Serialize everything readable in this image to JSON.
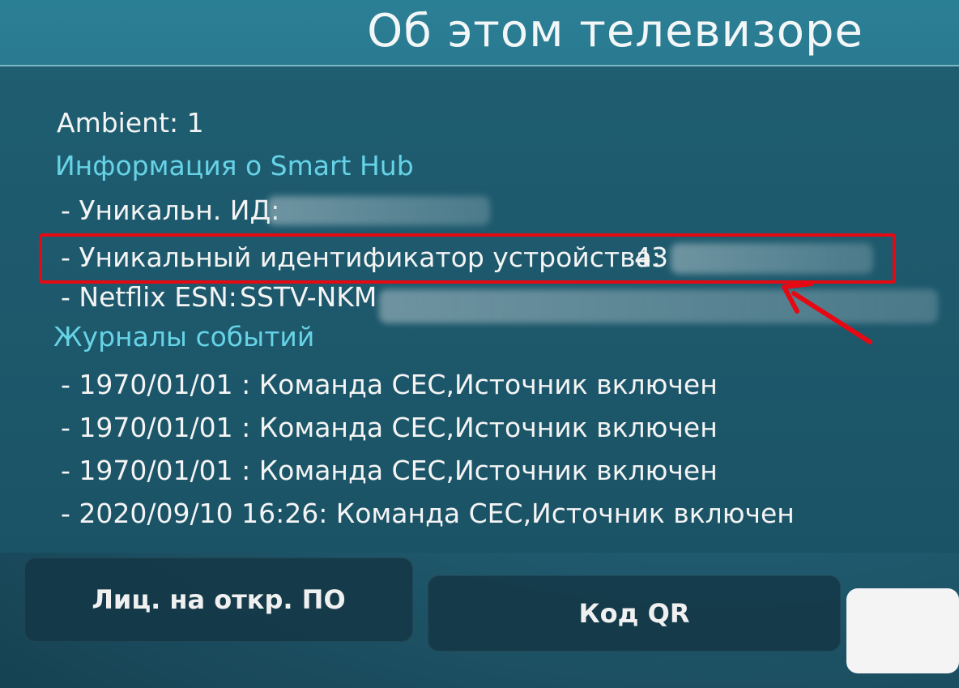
{
  "header": {
    "title": "Об этом телевизоре"
  },
  "info": {
    "ambient": "Ambient: 1",
    "smart_hub_heading": "Информация о Smart Hub",
    "unique_id_label": "- Уникальн. ИД:",
    "device_id_label": "- Уникальный идентификатор устройства:",
    "device_id_value": "43",
    "netflix_label": "- Netflix ESN:",
    "netflix_value": "SSTV-NKM"
  },
  "event_logs": {
    "heading": "Журналы событий",
    "entries": [
      "- 1970/01/01 : Команда CEC,Источник включен",
      "- 1970/01/01 : Команда CEC,Источник включен",
      "- 1970/01/01 : Команда CEC,Источник включен",
      "- 2020/09/10 16:26: Команда CEC,Источник включен"
    ]
  },
  "buttons": {
    "open_source_label": "Лиц. на откр. ПО",
    "qr_label": "Код QR"
  },
  "colors": {
    "highlight": "#e50914",
    "heading_cyan": "#67d3e6"
  }
}
